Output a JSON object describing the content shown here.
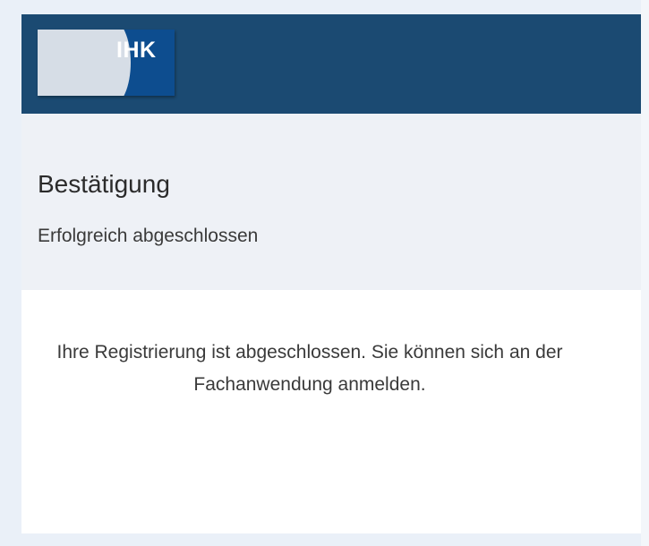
{
  "header": {
    "logo_text": "IHK",
    "background_color": "#1b4a72"
  },
  "confirmation": {
    "title": "Bestätigung",
    "subtitle": "Erfolgreich abgeschlossen"
  },
  "content": {
    "message": "Ihre Registrierung ist abgeschlossen. Sie können sich an der Fachanwendung anmelden."
  }
}
